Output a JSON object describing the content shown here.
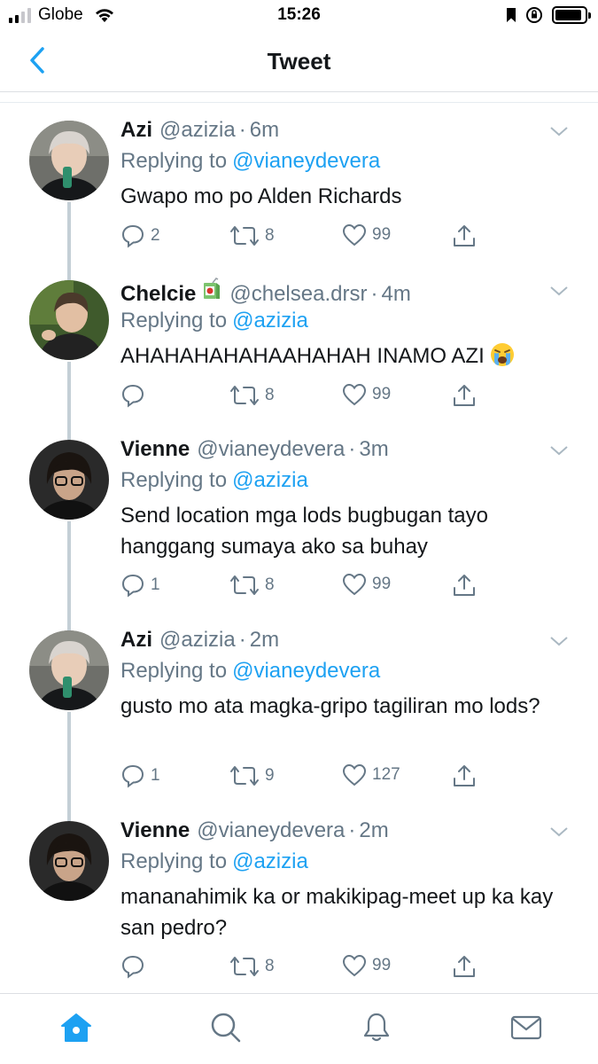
{
  "status_bar": {
    "carrier": "Globe",
    "time": "15:26",
    "signal_bars_filled": 2,
    "battery_level": 0.9
  },
  "nav": {
    "title": "Tweet",
    "back_icon": "chevron-left-icon"
  },
  "colors": {
    "accent": "#1da1f2",
    "text": "#14171a",
    "muted": "#657786",
    "thread_line": "#c4cfd6"
  },
  "tweets": [
    {
      "name": "Azi",
      "handle": "@azizia",
      "time": "6m",
      "reply_label": "Replying to",
      "reply_to": "@vianeydevera",
      "body": "Gwapo mo po Alden Richards",
      "replies": "2",
      "retweets": "8",
      "likes": "99"
    },
    {
      "name": "Chelcie",
      "name_emoji": "juice-box-emoji",
      "handle": "@chelsea.drsr",
      "time": "4m",
      "reply_label": "Replying to",
      "reply_to": "@azizia",
      "body": "AHAHAHAHAHAAHAHAH INAMO AZI",
      "body_emoji": "crying-face-emoji",
      "replies": "",
      "retweets": "8",
      "likes": "99"
    },
    {
      "name": "Vienne",
      "handle": "@vianeydevera",
      "time": "3m",
      "reply_label": "Replying to",
      "reply_to": "@azizia",
      "body": "Send location mga lods bugbugan tayo hanggang sumaya ako sa buhay",
      "replies": "1",
      "retweets": "8",
      "likes": "99"
    },
    {
      "name": "Azi",
      "handle": "@azizia",
      "time": "2m",
      "reply_label": "Replying to",
      "reply_to": "@vianeydevera",
      "body": "gusto mo ata magka-gripo tagiliran mo lods?",
      "replies": "1",
      "retweets": "9",
      "likes": "127"
    },
    {
      "name": "Vienne",
      "handle": "@vianeydevera",
      "time": "2m",
      "reply_label": "Replying to",
      "reply_to": "@azizia",
      "body": "mananahimik ka or makikipag-meet up ka kay san pedro?",
      "replies": "",
      "retweets": "8",
      "likes": "99"
    }
  ],
  "tab_bar": {
    "items": [
      "home-icon",
      "search-icon",
      "notifications-icon",
      "messages-icon"
    ],
    "active": "home-icon"
  }
}
